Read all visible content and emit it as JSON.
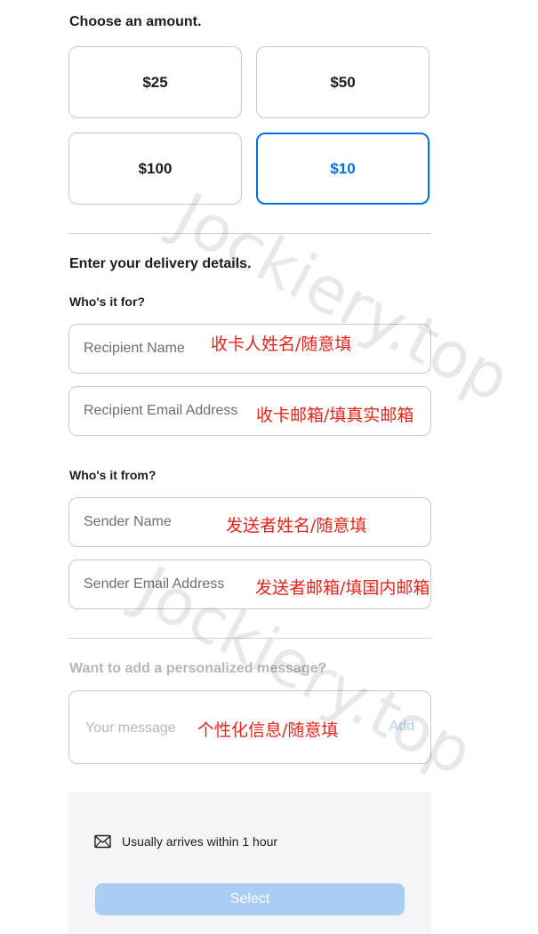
{
  "amount_section": {
    "title": "Choose an amount.",
    "options": [
      "$25",
      "$50",
      "$100",
      "$10"
    ],
    "selected": "$10"
  },
  "delivery": {
    "title": "Enter your delivery details.",
    "for_label": "Who's it for?",
    "recipient_name_placeholder": "Recipient Name",
    "recipient_email_placeholder": "Recipient Email Address",
    "from_label": "Who's it from?",
    "sender_name_placeholder": "Sender Name",
    "sender_email_placeholder": "Sender Email Address"
  },
  "message": {
    "label": "Want to add a personalized message?",
    "placeholder": "Your message",
    "add_label": "Add"
  },
  "annotations": {
    "recipient_name": "收卡人姓名/随意填",
    "recipient_email": "收卡邮箱/填真实邮箱",
    "sender_name": "发送者姓名/随意填",
    "sender_email": "发送者邮箱/填国内邮箱",
    "message": "个性化信息/随意填"
  },
  "delivery_info": {
    "text": "Usually arrives within 1 hour"
  },
  "select_button": {
    "label": "Select"
  },
  "watermark": "Jockiery.top",
  "colors": {
    "accent": "#0071e3",
    "annotation": "#e8241a",
    "select_disabled": "#a9cdf4"
  }
}
